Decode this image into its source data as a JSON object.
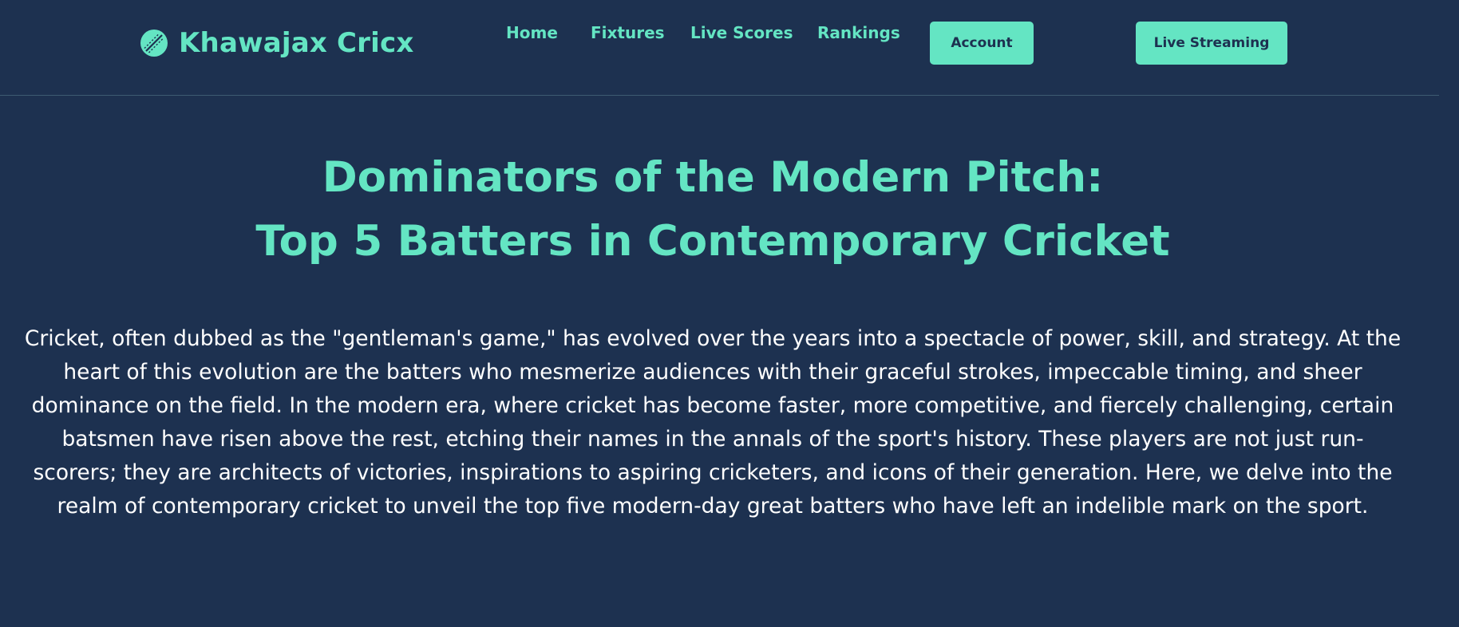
{
  "brand": {
    "name": "Khawajax Cricx",
    "icon": "cricket-ball-icon"
  },
  "nav": {
    "links": [
      {
        "label": "Home"
      },
      {
        "label": "Fixtures"
      },
      {
        "label": "Live Scores"
      },
      {
        "label": "Rankings"
      }
    ],
    "account_label": "Account",
    "live_streaming_label": "Live Streaming"
  },
  "article": {
    "title_line1": "Dominators of the Modern Pitch:",
    "title_line2": "Top 5 Batters in Contemporary Cricket",
    "intro": "Cricket, often dubbed as the \"gentleman's game,\" has evolved over the years into a spectacle of power, skill, and strategy. At the heart of this evolution are the batters who mesmerize audiences with their graceful strokes, impeccable timing, and sheer dominance on the field. In the modern era, where cricket has become faster, more competitive, and fiercely challenging, certain batsmen have risen above the rest, etching their names in the annals of the sport's history. These players are not just run-scorers; they are architects of victories, inspirations to aspiring cricketers, and icons of their generation. Here, we delve into the realm of contemporary cricket to unveil the top five modern-day great batters who have left an indelible mark on the sport."
  },
  "colors": {
    "background": "#1d3150",
    "accent": "#64e5c3",
    "text": "#ffffff",
    "divider": "#3d5a72"
  }
}
